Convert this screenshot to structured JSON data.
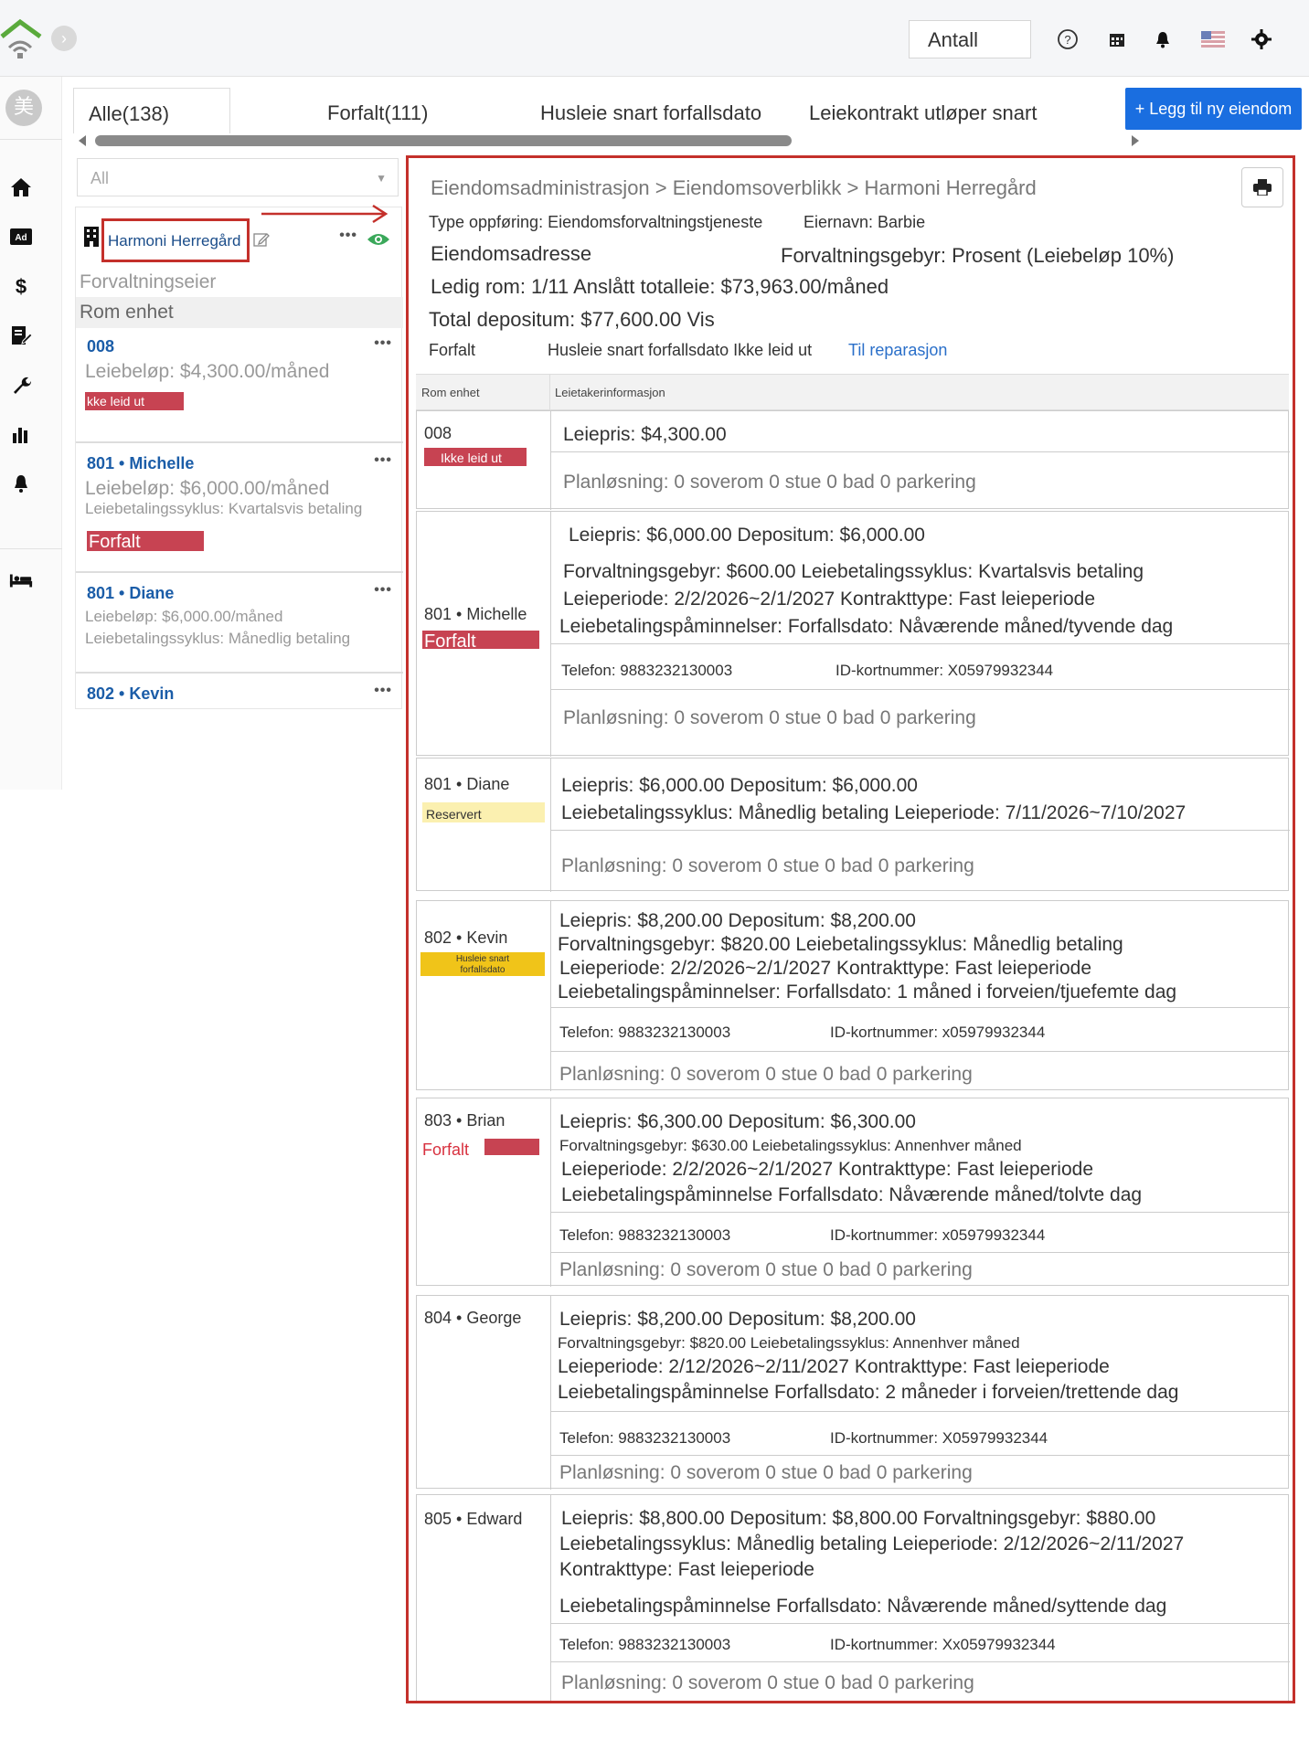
{
  "topbar": {
    "antall_label": "Antall",
    "icons": [
      "help-icon",
      "calendar-icon",
      "bell-icon",
      "flag-us-icon",
      "gear-icon"
    ]
  },
  "sidebar": {
    "avatar_text": "美",
    "items": [
      "home-icon",
      "ad-icon",
      "dollar-icon",
      "edit-doc-icon",
      "wrench-icon",
      "bar-chart-icon",
      "bell-icon",
      "bed-icon"
    ]
  },
  "tabs": [
    {
      "label": "Alle(138)"
    },
    {
      "label": "Forfalt(111)"
    },
    {
      "label": "Husleie snart forfallsdato"
    },
    {
      "label": "Leiekontrakt utløper snart"
    }
  ],
  "add_button": "+ Legg til ny eiendom",
  "filter": {
    "value": "All"
  },
  "left": {
    "property_name": "Harmoni Herregård",
    "owner_label": "Forvaltningseier",
    "rom_label": "Rom enhet",
    "units": [
      {
        "title": "008",
        "line1": "Leiebeløp: $4,300.00/måned",
        "tag": "kke leid ut"
      },
      {
        "title": "801 • Michelle",
        "line1": "Leiebeløp: $6,000.00/måned",
        "line2": "Leiebetalingssyklus: Kvartalsvis betaling",
        "tag": "Forfalt"
      },
      {
        "title": "801 • Diane",
        "line1": "Leiebeløp: $6,000.00/måned",
        "line2": "Leiebetalingssyklus: Månedlig betaling"
      },
      {
        "title": "802 • Kevin"
      }
    ]
  },
  "detail": {
    "breadcrumb": "Eiendomsadministrasjon > Eiendomsoverblikk > Harmoni Herregård",
    "type_line": "Type oppføring: Eiendomsforvaltningstjeneste",
    "owner_line": "Eiernavn: Barbie",
    "address_label": "Eiendomsadresse",
    "fee_line": "Forvaltningsgebyr: Prosent (Leiebeløp 10%)",
    "vacancy_line": "Ledig rom: 1/11 Anslått totalleie: $73,963.00/måned",
    "deposit_line": "Total depositum: $77,600.00 Vis",
    "status_forfalt": "Forfalt",
    "status_mid": "Husleie snart forfallsdato Ikke leid ut",
    "status_link": "Til reparasjon",
    "col1": "Rom enhet",
    "col2": "Leietakerinformasjon",
    "rows": [
      {
        "unit": "008",
        "tag": "Ikke leid ut",
        "l1": "Leiepris: $4,300.00",
        "plan": "Planløsning: 0 soverom 0 stue 0 bad 0 parkering"
      },
      {
        "unit": "801 • Michelle",
        "tag": "Forfalt",
        "l1": "Leiepris: $6,000.00 Depositum: $6,000.00",
        "l2": "Forvaltningsgebyr: $600.00 Leiebetalingssyklus: Kvartalsvis betaling",
        "l3": "Leieperiode: 2/2/2026~2/1/2027 Kontrakttype: Fast leieperiode",
        "l4": "Leiebetalingspåminnelser: Forfallsdato: Nåværende måned/tyvende dag",
        "phone": "Telefon: 9883232130003",
        "id": "ID-kortnummer: X05979932344",
        "plan": "Planløsning: 0 soverom 0 stue 0 bad 0 parkering"
      },
      {
        "unit": "801 • Diane",
        "tag": "Reservert",
        "l1": "Leiepris: $6,000.00 Depositum: $6,000.00",
        "l2": "Leiebetalingssyklus: Månedlig betaling Leieperiode: 7/11/2026~7/10/2027",
        "plan": "Planløsning: 0 soverom 0 stue 0 bad 0 parkering"
      },
      {
        "unit": "802 • Kevin",
        "tag": "Husleie snart forfallsdato",
        "l1": "Leiepris: $8,200.00 Depositum: $8,200.00",
        "l2": "Forvaltningsgebyr: $820.00 Leiebetalingssyklus: Månedlig betaling",
        "l3": "Leieperiode: 2/2/2026~2/1/2027 Kontrakttype: Fast leieperiode",
        "l4": "Leiebetalingspåminnelser: Forfallsdato: 1 måned i forveien/tjuefemte dag",
        "phone": "Telefon: 9883232130003",
        "id": "ID-kortnummer: x05979932344",
        "plan": "Planløsning: 0 soverom 0 stue 0 bad 0 parkering"
      },
      {
        "unit": "803 • Brian",
        "tag": "Forfalt",
        "l1": "Leiepris: $6,300.00 Depositum: $6,300.00",
        "l2": "Forvaltningsgebyr: $630.00 Leiebetalingssyklus: Annenhver måned",
        "l3": "Leieperiode: 2/2/2026~2/1/2027 Kontrakttype: Fast leieperiode",
        "l4": "Leiebetalingspåminnelse  Forfallsdato: Nåværende måned/tolvte dag",
        "phone": "Telefon: 9883232130003",
        "id": "ID-kortnummer: x05979932344",
        "plan": "Planløsning: 0 soverom 0 stue 0 bad 0 parkering"
      },
      {
        "unit": "804 • George",
        "l1": "Leiepris: $8,200.00 Depositum: $8,200.00",
        "l2": "Forvaltningsgebyr: $820.00 Leiebetalingssyklus: Annenhver måned",
        "l3": "Leieperiode: 2/12/2026~2/11/2027 Kontrakttype: Fast leieperiode",
        "l4": "Leiebetalingspåminnelse  Forfallsdato: 2 måneder i forveien/trettende dag",
        "phone": "Telefon: 9883232130003",
        "id": "ID-kortnummer: X05979932344",
        "plan": "Planløsning: 0 soverom 0 stue 0 bad 0 parkering"
      },
      {
        "unit": "805 • Edward",
        "l1": "Leiepris: $8,800.00 Depositum: $8,800.00 Forvaltningsgebyr: $880.00",
        "l2": "Leiebetalingssyklus: Månedlig betaling Leieperiode: 2/12/2026~2/11/2027",
        "l3": "Kontrakttype: Fast leieperiode",
        "l4": "Leiebetalingspåminnelse  Forfallsdato: Nåværende måned/syttende dag",
        "phone": "Telefon: 9883232130003",
        "id": "ID-kortnummer: Xx05979932344",
        "plan": "Planløsning: 0 soverom 0 stue 0 bad 0 parkering"
      }
    ]
  },
  "colors": {
    "accent": "#1a6ee0",
    "highlight_border": "#c4302b",
    "tag_red": "#c74352",
    "tag_yellow": "#f0c419"
  }
}
